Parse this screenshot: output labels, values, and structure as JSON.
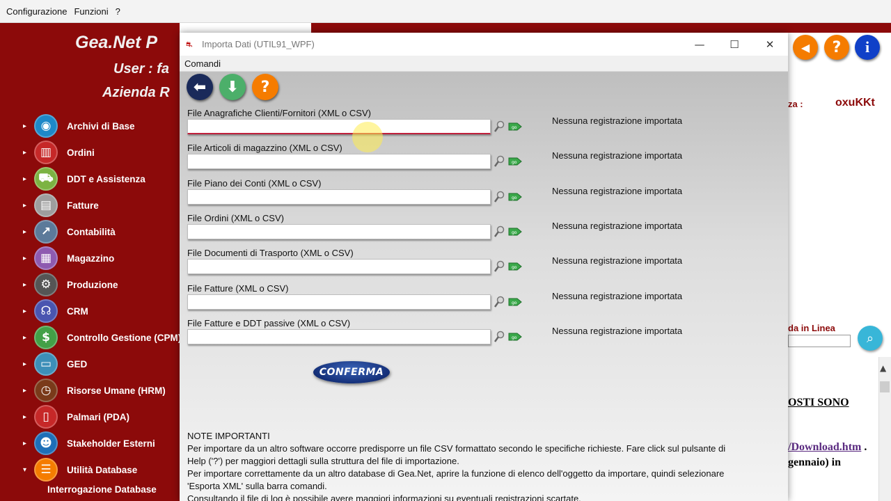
{
  "main_menu": [
    "Configurazione",
    "Funzioni",
    "?"
  ],
  "app": {
    "title": "Gea.Net P",
    "user": "User : fa",
    "azienda": "Azienda R"
  },
  "nav": {
    "items": [
      {
        "label": "Archivi di Base",
        "icon": "globe-icon",
        "color": "#1e88c8",
        "glyph": "◉"
      },
      {
        "label": "Ordini",
        "icon": "book-icon",
        "color": "#c62828",
        "glyph": "▥"
      },
      {
        "label": "DDT e Assistenza",
        "icon": "cart-icon",
        "color": "#7cb342",
        "glyph": "⛟"
      },
      {
        "label": "Fatture",
        "icon": "invoice-icon",
        "color": "#9e9e9e",
        "glyph": "▤"
      },
      {
        "label": "Contabilità",
        "icon": "chart-icon",
        "color": "#5c7a9a",
        "glyph": "↗"
      },
      {
        "label": "Magazzino",
        "icon": "warehouse-icon",
        "color": "#8e5ab0",
        "glyph": "▦"
      },
      {
        "label": "Produzione",
        "icon": "gear-icon",
        "color": "#555555",
        "glyph": "⚙"
      },
      {
        "label": "CRM",
        "icon": "headset-icon",
        "color": "#4a55b0",
        "glyph": "☊"
      },
      {
        "label": "Controllo Gestione (CPM)",
        "icon": "dollar-icon",
        "color": "#43a047",
        "glyph": "$"
      },
      {
        "label": "GED",
        "icon": "monitor-icon",
        "color": "#3d8fb8",
        "glyph": "▭"
      },
      {
        "label": "Risorse Umane (HRM)",
        "icon": "clock-icon",
        "color": "#7a3a1a",
        "glyph": "◷"
      },
      {
        "label": "Palmari (PDA)",
        "icon": "tablet-icon",
        "color": "#c62828",
        "glyph": "▯"
      },
      {
        "label": "Stakeholder Esterni",
        "icon": "people-icon",
        "color": "#1e6fb8",
        "glyph": "☻"
      },
      {
        "label": "Utilità Database",
        "icon": "database-icon",
        "color": "#f57c00",
        "glyph": "☰"
      }
    ],
    "sub_item": "Interrogazione Database"
  },
  "right_panel": {
    "licenza_label": "nza :",
    "licenza_value": "oxuKKt",
    "guida_label": "da in Linea",
    "news1": "OSTI SONO",
    "news2_link": "/Download.htm",
    "news2_tail": " .",
    "news3": "gennaio) in"
  },
  "dialog": {
    "title": "Importa Dati (UTIL91_WPF)",
    "menu": "Comandi",
    "rows": [
      {
        "label": "File Anagrafiche Clienti/Fornitori (XML o CSV)",
        "value": "",
        "status": "Nessuna registrazione importata"
      },
      {
        "label": "File Articoli di magazzino (XML o CSV)",
        "value": "",
        "status": "Nessuna registrazione importata"
      },
      {
        "label": "File Piano dei Conti (XML o CSV)",
        "value": "",
        "status": "Nessuna registrazione importata"
      },
      {
        "label": "File Ordini (XML o CSV)",
        "value": "",
        "status": "Nessuna registrazione importata"
      },
      {
        "label": "File Documenti di Trasporto (XML o CSV)",
        "value": "",
        "status": "Nessuna registrazione importata"
      },
      {
        "label": "File Fatture (XML o CSV)",
        "value": "",
        "status": "Nessuna registrazione importata"
      },
      {
        "label": "File Fatture e DDT passive (XML o CSV)",
        "value": "",
        "status": "Nessuna registrazione importata"
      }
    ],
    "confirm_label": "CONFERMA",
    "notes_title": "NOTE IMPORTANTI",
    "notes": [
      "Per importare da un altro software occorre predisporre un file CSV formattato secondo le specifiche richieste. Fare click sul pulsante di",
      "Help ('?') per maggiori dettagli sulla struttura del file di importazione.",
      "Per importare correttamente da un altro database di Gea.Net, aprire la funzione di elenco dell'oggetto da importare, quindi selezionare",
      "'Esporta XML' sulla barra comandi.",
      "Consultando il file di log è possibile avere maggiori informazioni su eventuali registrazioni scartate."
    ]
  },
  "colors": {
    "sidebar_red": "#8c0a0a",
    "toolbar_back": "#1a2a5a",
    "toolbar_download": "#4caf6a",
    "toolbar_help": "#f57c00"
  }
}
